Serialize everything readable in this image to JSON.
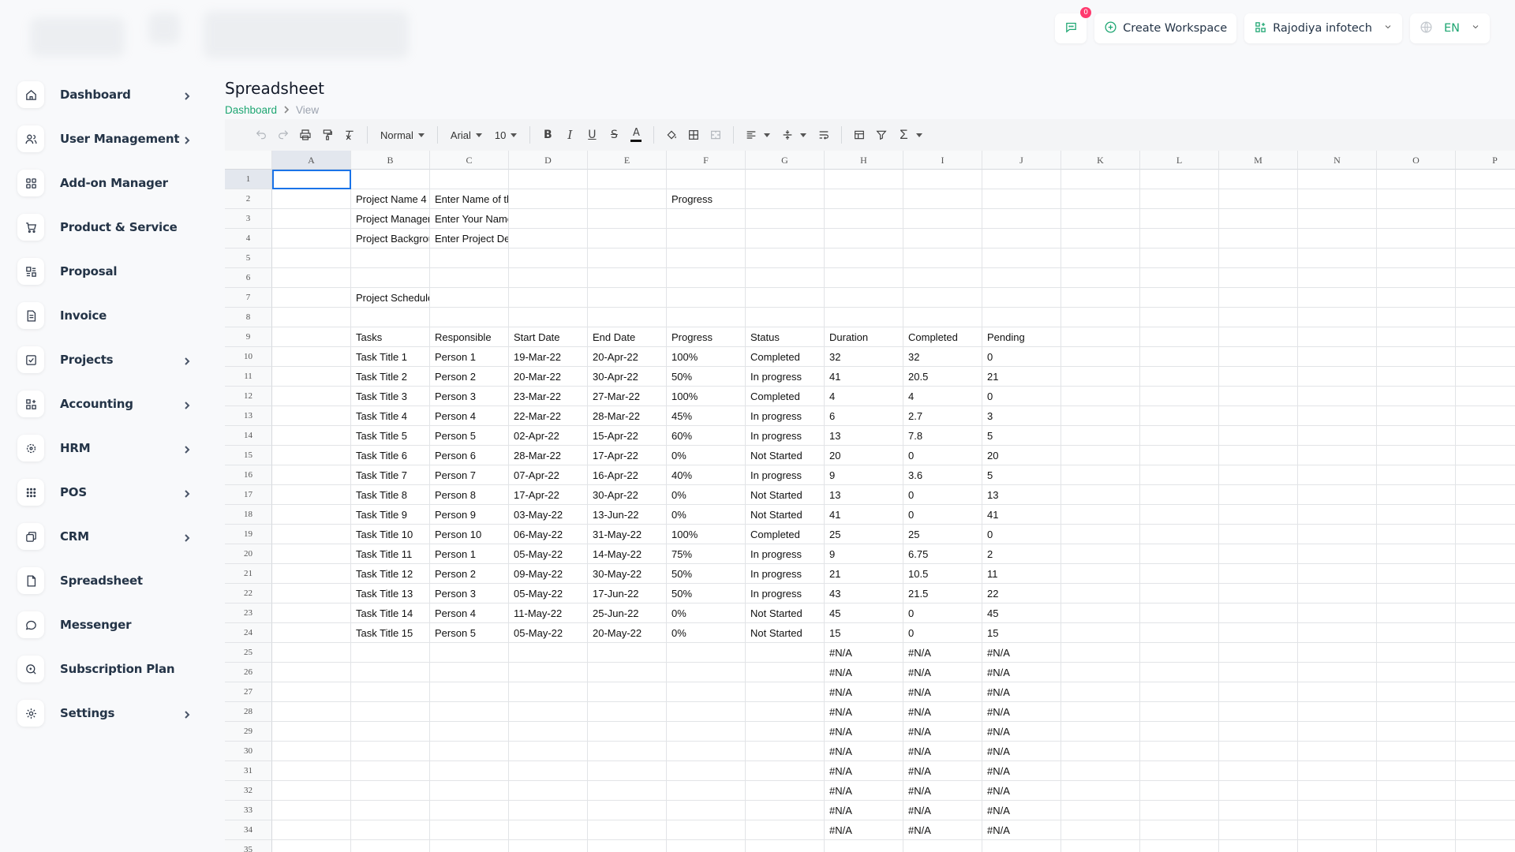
{
  "sidebar": {
    "items": [
      {
        "label": "Dashboard",
        "icon": "home-icon",
        "chevron": true
      },
      {
        "label": "User Management",
        "icon": "users-icon",
        "chevron": true
      },
      {
        "label": "Add-on Manager",
        "icon": "apps-icon",
        "chevron": false
      },
      {
        "label": "Product & Service",
        "icon": "cart-icon",
        "chevron": false
      },
      {
        "label": "Proposal",
        "icon": "proposal-icon",
        "chevron": false
      },
      {
        "label": "Invoice",
        "icon": "invoice-icon",
        "chevron": false
      },
      {
        "label": "Projects",
        "icon": "checklist-icon",
        "chevron": true
      },
      {
        "label": "Accounting",
        "icon": "accounting-icon",
        "chevron": true
      },
      {
        "label": "HRM",
        "icon": "hrm-icon",
        "chevron": true
      },
      {
        "label": "POS",
        "icon": "grid-dots-icon",
        "chevron": true
      },
      {
        "label": "CRM",
        "icon": "crm-icon",
        "chevron": true
      },
      {
        "label": "Spreadsheet",
        "icon": "file-icon",
        "chevron": false
      },
      {
        "label": "Messenger",
        "icon": "chat-icon",
        "chevron": false
      },
      {
        "label": "Subscription Plan",
        "icon": "subscription-icon",
        "chevron": false
      },
      {
        "label": "Settings",
        "icon": "gear-icon",
        "chevron": true
      }
    ]
  },
  "topbar": {
    "notification_count": "0",
    "create_workspace": "Create Workspace",
    "workspace_name": "Rajodiya infotech",
    "language": "EN"
  },
  "page": {
    "title": "Spreadsheet",
    "breadcrumb": [
      "Dashboard",
      "View"
    ]
  },
  "toolbar": {
    "style_select": "Normal",
    "font_select": "Arial",
    "size_select": "10"
  },
  "sheet": {
    "columns": [
      "A",
      "B",
      "C",
      "D",
      "E",
      "F",
      "G",
      "H",
      "I",
      "J",
      "K",
      "L",
      "M",
      "N",
      "O",
      "P"
    ],
    "first_row": 1,
    "last_row": 35,
    "selected_cell": "A1",
    "rows": {
      "2": {
        "B": "Project Name 4",
        "C": "Enter Name of th",
        "F": "Progress"
      },
      "3": {
        "B": "Project Manager",
        "C": "Enter Your Name"
      },
      "4": {
        "B": "Project Backgrou",
        "C": "Enter Project De"
      },
      "7": {
        "B": "Project Schedule"
      },
      "9": {
        "B": "Tasks",
        "C": "Responsible",
        "D": "Start Date",
        "E": "End Date",
        "F": "Progress",
        "G": "Status",
        "H": "Duration",
        "I": "Completed",
        "J": "Pending"
      },
      "10": {
        "B": "Task Title 1",
        "C": "Person 1",
        "D": "19-Mar-22",
        "E": "20-Apr-22",
        "F": "100%",
        "G": "Completed",
        "H": "32",
        "I": "32",
        "J": "0"
      },
      "11": {
        "B": "Task Title 2",
        "C": "Person 2",
        "D": "20-Mar-22",
        "E": "30-Apr-22",
        "F": "50%",
        "G": "In progress",
        "H": "41",
        "I": "20.5",
        "J": "21"
      },
      "12": {
        "B": "Task Title 3",
        "C": "Person 3",
        "D": "23-Mar-22",
        "E": "27-Mar-22",
        "F": "100%",
        "G": "Completed",
        "H": "4",
        "I": "4",
        "J": "0"
      },
      "13": {
        "B": "Task Title 4",
        "C": "Person 4",
        "D": "22-Mar-22",
        "E": "28-Mar-22",
        "F": "45%",
        "G": "In progress",
        "H": "6",
        "I": "2.7",
        "J": "3"
      },
      "14": {
        "B": "Task Title 5",
        "C": "Person 5",
        "D": "02-Apr-22",
        "E": "15-Apr-22",
        "F": "60%",
        "G": "In progress",
        "H": "13",
        "I": "7.8",
        "J": "5"
      },
      "15": {
        "B": "Task Title 6",
        "C": "Person 6",
        "D": "28-Mar-22",
        "E": "17-Apr-22",
        "F": "0%",
        "G": "Not Started",
        "H": "20",
        "I": "0",
        "J": "20"
      },
      "16": {
        "B": "Task Title 7",
        "C": "Person 7",
        "D": "07-Apr-22",
        "E": "16-Apr-22",
        "F": "40%",
        "G": "In progress",
        "H": "9",
        "I": "3.6",
        "J": "5"
      },
      "17": {
        "B": "Task Title 8",
        "C": "Person 8",
        "D": "17-Apr-22",
        "E": "30-Apr-22",
        "F": "0%",
        "G": "Not Started",
        "H": "13",
        "I": "0",
        "J": "13"
      },
      "18": {
        "B": "Task Title 9",
        "C": "Person 9",
        "D": "03-May-22",
        "E": "13-Jun-22",
        "F": "0%",
        "G": "Not Started",
        "H": "41",
        "I": "0",
        "J": "41"
      },
      "19": {
        "B": "Task Title 10",
        "C": "Person 10",
        "D": "06-May-22",
        "E": "31-May-22",
        "F": "100%",
        "G": "Completed",
        "H": "25",
        "I": "25",
        "J": "0"
      },
      "20": {
        "B": "Task Title 11",
        "C": "Person 1",
        "D": "05-May-22",
        "E": "14-May-22",
        "F": "75%",
        "G": "In progress",
        "H": "9",
        "I": "6.75",
        "J": "2"
      },
      "21": {
        "B": "Task Title 12",
        "C": "Person 2",
        "D": "09-May-22",
        "E": "30-May-22",
        "F": "50%",
        "G": "In progress",
        "H": "21",
        "I": "10.5",
        "J": "11"
      },
      "22": {
        "B": "Task Title 13",
        "C": "Person 3",
        "D": "05-May-22",
        "E": "17-Jun-22",
        "F": "50%",
        "G": "In progress",
        "H": "43",
        "I": "21.5",
        "J": "22"
      },
      "23": {
        "B": "Task Title 14",
        "C": "Person 4",
        "D": "11-May-22",
        "E": "25-Jun-22",
        "F": "0%",
        "G": "Not Started",
        "H": "45",
        "I": "0",
        "J": "45"
      },
      "24": {
        "B": "Task Title 15",
        "C": "Person 5",
        "D": "05-May-22",
        "E": "20-May-22",
        "F": "0%",
        "G": "Not Started",
        "H": "15",
        "I": "0",
        "J": "15"
      },
      "25": {
        "H": "#N/A",
        "I": "#N/A",
        "J": "#N/A"
      },
      "26": {
        "H": "#N/A",
        "I": "#N/A",
        "J": "#N/A"
      },
      "27": {
        "H": "#N/A",
        "I": "#N/A",
        "J": "#N/A"
      },
      "28": {
        "H": "#N/A",
        "I": "#N/A",
        "J": "#N/A"
      },
      "29": {
        "H": "#N/A",
        "I": "#N/A",
        "J": "#N/A"
      },
      "30": {
        "H": "#N/A",
        "I": "#N/A",
        "J": "#N/A"
      },
      "31": {
        "H": "#N/A",
        "I": "#N/A",
        "J": "#N/A"
      },
      "32": {
        "H": "#N/A",
        "I": "#N/A",
        "J": "#N/A"
      },
      "33": {
        "H": "#N/A",
        "I": "#N/A",
        "J": "#N/A"
      },
      "34": {
        "H": "#N/A",
        "I": "#N/A",
        "J": "#N/A"
      }
    }
  },
  "colors": {
    "accent": "#1ea672",
    "badge": "#ff3a6e",
    "selection": "#1a73e8"
  }
}
